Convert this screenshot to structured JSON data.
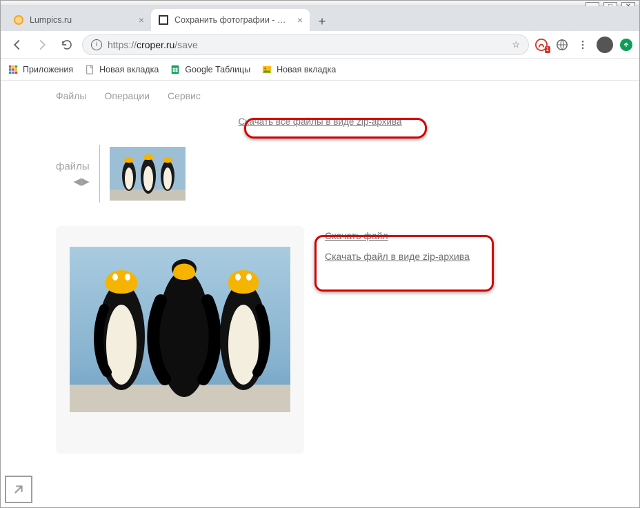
{
  "window": {
    "minimize": "—",
    "maximize": "□",
    "close": "✕"
  },
  "tabs": [
    {
      "label": "Lumpics.ru",
      "active": false
    },
    {
      "label": "Сохранить фотографии - Онлайн",
      "active": true
    }
  ],
  "new_tab": "+",
  "address": {
    "protocol": "https://",
    "host": "croper.ru",
    "path": "/save"
  },
  "nav": {
    "back": "←",
    "forward": "→",
    "reload": "⟳"
  },
  "star": "☆",
  "ext_badge": "1",
  "bookmarks": {
    "apps": "Приложения",
    "newtab1": "Новая вкладка",
    "gsheets": "Google Таблицы",
    "newtab2": "Новая вкладка"
  },
  "menu": {
    "files": "Файлы",
    "operations": "Операции",
    "service": "Сервис"
  },
  "download_all": "Скачать все файлы в виде zip-архива",
  "files_label": "файлы",
  "side_links": {
    "download": "Скачать файл",
    "download_zip": "Скачать файл в виде zip-архива"
  }
}
